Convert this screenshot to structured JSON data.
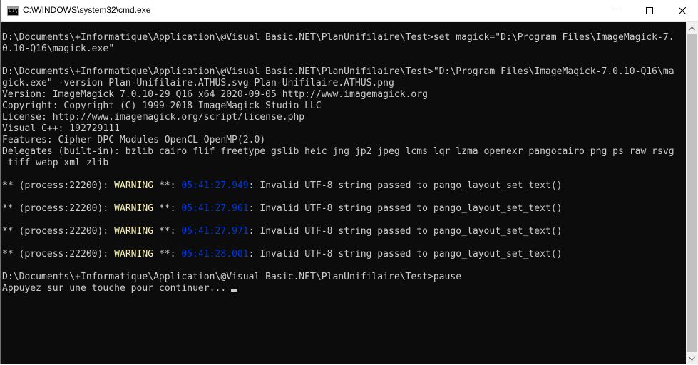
{
  "window": {
    "title": "C:\\WINDOWS\\system32\\cmd.exe",
    "icon": "cmd-icon",
    "app_icon_glyph": "C:\\"
  },
  "console": {
    "lines": [
      {
        "type": "text",
        "text": "D:\\Documents\\+Informatique\\Application\\@Visual Basic.NET\\PlanUnifilaire\\Test>set magick=\"D:\\Program Files\\ImageMagick-7."
      },
      {
        "type": "text",
        "text": "0.10-Q16\\magick.exe\""
      },
      {
        "type": "blank",
        "text": ""
      },
      {
        "type": "text",
        "text": "D:\\Documents\\+Informatique\\Application\\@Visual Basic.NET\\PlanUnifilaire\\Test>\"D:\\Program Files\\ImageMagick-7.0.10-Q16\\ma"
      },
      {
        "type": "text",
        "text": "gick.exe\" -version Plan-Unifilaire.ATHUS.svg Plan-Unifilaire.ATHUS.png"
      },
      {
        "type": "text",
        "text": "Version: ImageMagick 7.0.10-29 Q16 x64 2020-09-05 http://www.imagemagick.org"
      },
      {
        "type": "text",
        "text": "Copyright: Copyright (C) 1999-2018 ImageMagick Studio LLC"
      },
      {
        "type": "text",
        "text": "License: http://www.imagemagick.org/script/license.php"
      },
      {
        "type": "text",
        "text": "Visual C++: 192729111"
      },
      {
        "type": "text",
        "text": "Features: Cipher DPC Modules OpenCL OpenMP(2.0)"
      },
      {
        "type": "text",
        "text": "Delegates (built-in): bzlib cairo flif freetype gslib heic jng jp2 jpeg lcms lqr lzma openexr pangocairo png ps raw rsvg"
      },
      {
        "type": "text",
        "text": " tiff webp xml zlib"
      },
      {
        "type": "blank",
        "text": ""
      },
      {
        "type": "warning",
        "pre": "** (process:22200): ",
        "warn": "WARNING",
        "mid": " **: ",
        "ts": "05:41:27.949",
        "post": ": Invalid UTF-8 string passed to pango_layout_set_text()"
      },
      {
        "type": "blank",
        "text": ""
      },
      {
        "type": "warning",
        "pre": "** (process:22200): ",
        "warn": "WARNING",
        "mid": " **: ",
        "ts": "05:41:27.961",
        "post": ": Invalid UTF-8 string passed to pango_layout_set_text()"
      },
      {
        "type": "blank",
        "text": ""
      },
      {
        "type": "warning",
        "pre": "** (process:22200): ",
        "warn": "WARNING",
        "mid": " **: ",
        "ts": "05:41:27.971",
        "post": ": Invalid UTF-8 string passed to pango_layout_set_text()"
      },
      {
        "type": "blank",
        "text": ""
      },
      {
        "type": "warning",
        "pre": "** (process:22200): ",
        "warn": "WARNING",
        "mid": " **: ",
        "ts": "05:41:28.001",
        "post": ": Invalid UTF-8 string passed to pango_layout_set_text()"
      },
      {
        "type": "blank",
        "text": ""
      },
      {
        "type": "text",
        "text": "D:\\Documents\\+Informatique\\Application\\@Visual Basic.NET\\PlanUnifilaire\\Test>pause"
      },
      {
        "type": "prompt",
        "text": "Appuyez sur une touche pour continuer..."
      }
    ]
  },
  "colors": {
    "background": "#0c0c0c",
    "text": "#cccccc",
    "warning": "#f9f1a5",
    "timestamp": "#0037da"
  }
}
